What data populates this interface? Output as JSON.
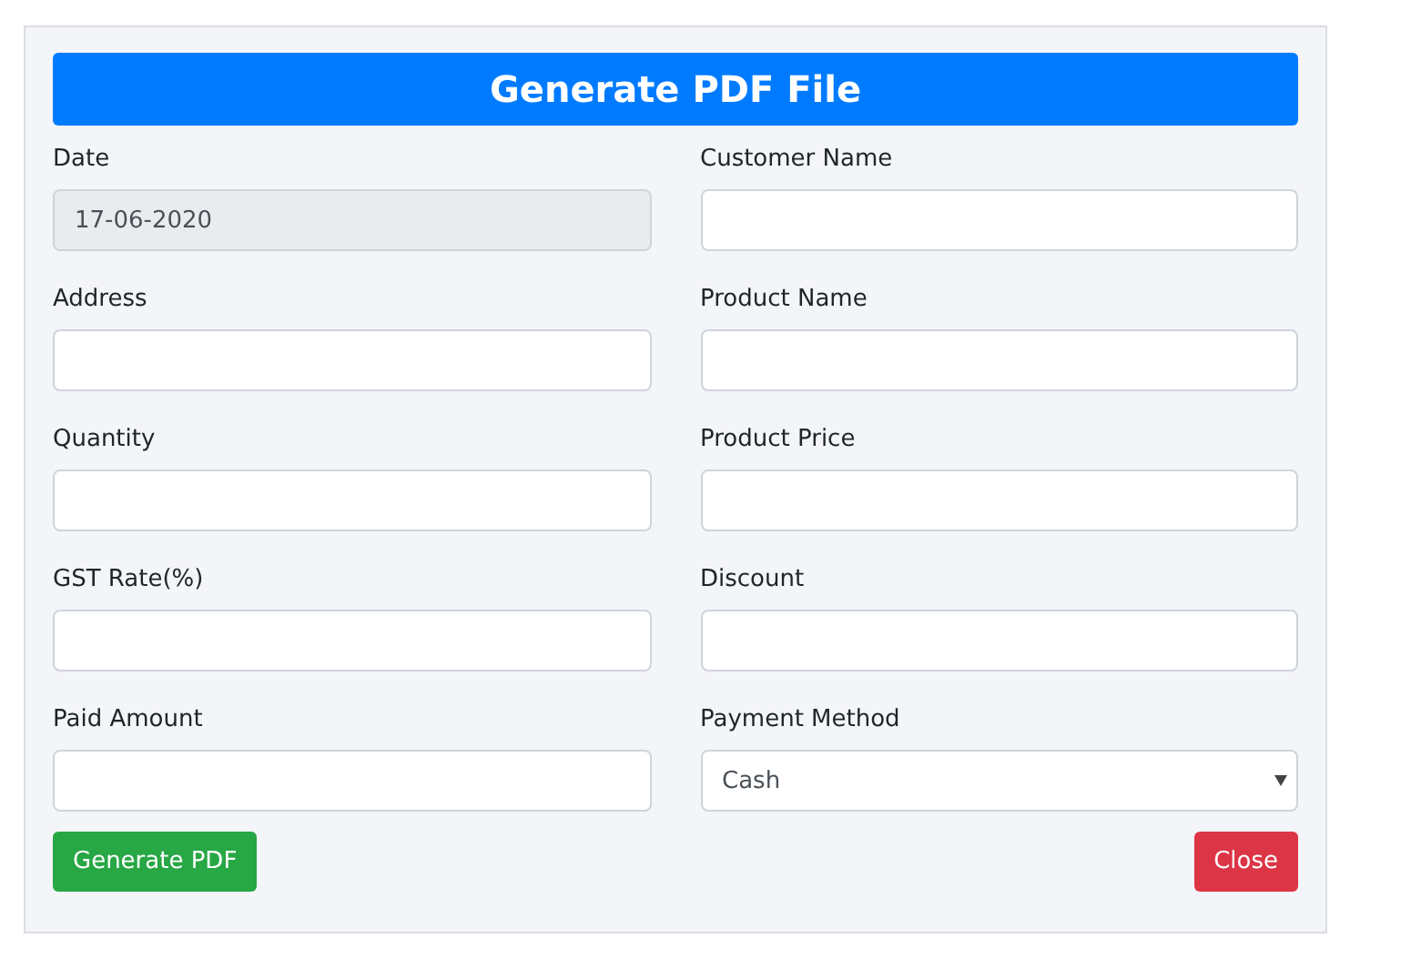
{
  "title": "Generate PDF File",
  "fields": [
    {
      "kind": "text",
      "label": "Date",
      "value": "17-06-2020",
      "disabled": true
    },
    {
      "kind": "text",
      "label": "Customer Name",
      "disabled": false
    },
    {
      "kind": "text",
      "label": "Address",
      "disabled": false
    },
    {
      "kind": "text",
      "label": "Product Name",
      "disabled": false
    },
    {
      "kind": "text",
      "label": "Quantity",
      "disabled": false
    },
    {
      "kind": "text",
      "label": "Product Price",
      "disabled": false
    },
    {
      "kind": "text",
      "label": "GST Rate(%)",
      "disabled": false
    },
    {
      "kind": "text",
      "label": "Discount",
      "disabled": false
    },
    {
      "kind": "text",
      "label": "Paid Amount",
      "disabled": false
    },
    {
      "kind": "select",
      "label": "Payment Method",
      "value": "Cash",
      "disabled": false
    }
  ],
  "buttons": [
    {
      "kind": "primary",
      "label": "Generate PDF"
    },
    {
      "kind": "danger",
      "label": "Close"
    }
  ]
}
